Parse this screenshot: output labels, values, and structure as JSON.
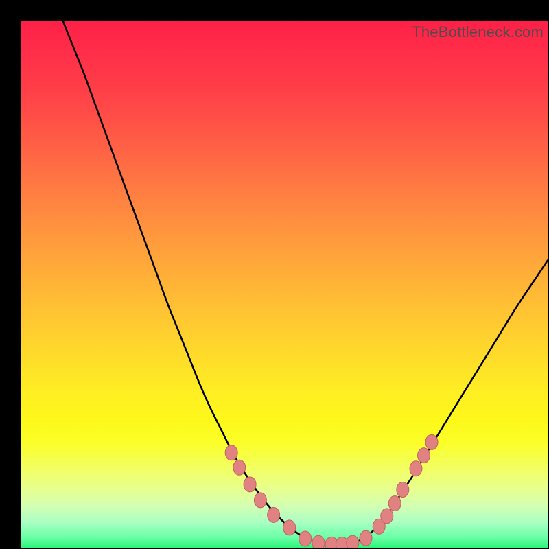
{
  "watermark": "TheBottleneck.com",
  "chart_data": {
    "type": "line",
    "title": "",
    "xlabel": "",
    "ylabel": "",
    "xlim": [
      0,
      100
    ],
    "ylim": [
      0,
      100
    ],
    "grid": false,
    "series": [
      {
        "name": "bottleneck-curve",
        "color": "#000000",
        "x": [
          8,
          10,
          12,
          14,
          16,
          18,
          20,
          22,
          24,
          26,
          28,
          30,
          32,
          34,
          36,
          38,
          40,
          42,
          44,
          46,
          48,
          50,
          52,
          54,
          56,
          58,
          60,
          62,
          64,
          66,
          68,
          70,
          74,
          78,
          82,
          86,
          90,
          94,
          98,
          100
        ],
        "y": [
          100,
          95,
          90,
          84.5,
          79,
          73.5,
          68,
          62.5,
          57,
          51.5,
          46,
          41,
          36,
          31,
          26.5,
          22.5,
          18.5,
          15,
          12,
          9.2,
          6.8,
          4.8,
          3.1,
          1.9,
          1.0,
          0.5,
          0.4,
          0.6,
          1.2,
          2.4,
          4.4,
          7.0,
          13.0,
          19.5,
          26.0,
          32.5,
          39.0,
          45.5,
          51.5,
          54.5
        ]
      }
    ],
    "markers": [
      {
        "name": "curve-beads",
        "color": "#e08282",
        "stroke": "#c46060",
        "points_xy": [
          [
            40.0,
            18.0
          ],
          [
            41.5,
            15.2
          ],
          [
            43.5,
            12.0
          ],
          [
            45.5,
            9.0
          ],
          [
            48.0,
            6.2
          ],
          [
            51.0,
            3.8
          ],
          [
            54.0,
            1.7
          ],
          [
            56.5,
            0.9
          ],
          [
            59.0,
            0.6
          ],
          [
            61.0,
            0.6
          ],
          [
            63.0,
            0.9
          ],
          [
            65.5,
            1.8
          ],
          [
            68.0,
            4.0
          ],
          [
            69.5,
            6.0
          ],
          [
            71.0,
            8.4
          ],
          [
            72.5,
            11.0
          ],
          [
            75.0,
            15.0
          ],
          [
            76.5,
            17.5
          ],
          [
            78.0,
            20.0
          ]
        ]
      }
    ]
  }
}
